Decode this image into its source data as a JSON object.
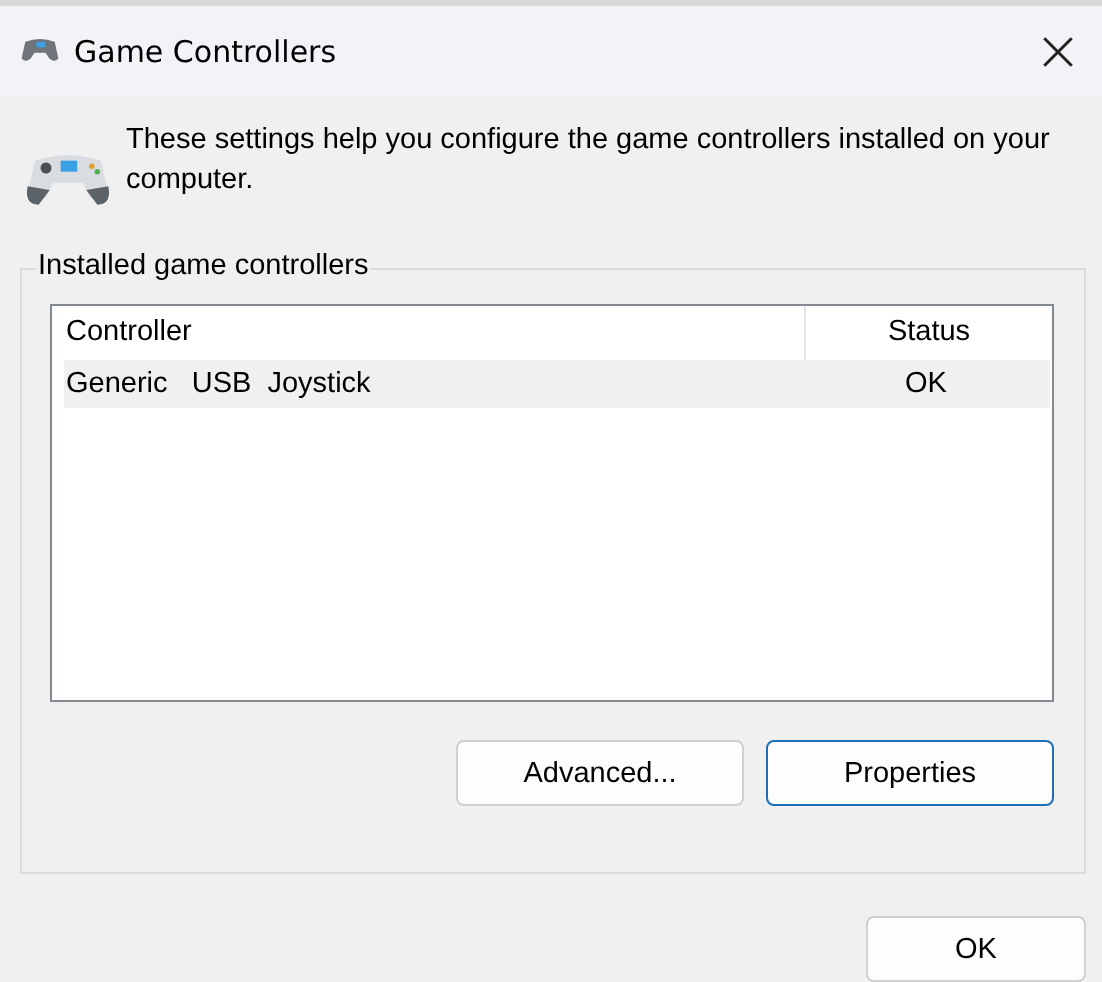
{
  "window": {
    "title": "Game Controllers"
  },
  "intro": "These settings help you configure the game controllers installed on your computer.",
  "group": {
    "label": "Installed game controllers",
    "table": {
      "columns": [
        "Controller",
        "Status"
      ],
      "rows": [
        {
          "cells": [
            "Generic   USB  Joystick",
            "OK"
          ],
          "selected": true
        }
      ]
    },
    "buttons": [
      {
        "label": "Advanced...",
        "focused": false
      },
      {
        "label": "Properties",
        "focused": true
      }
    ]
  },
  "footer_buttons": [
    {
      "label": "OK",
      "focused": false
    }
  ]
}
